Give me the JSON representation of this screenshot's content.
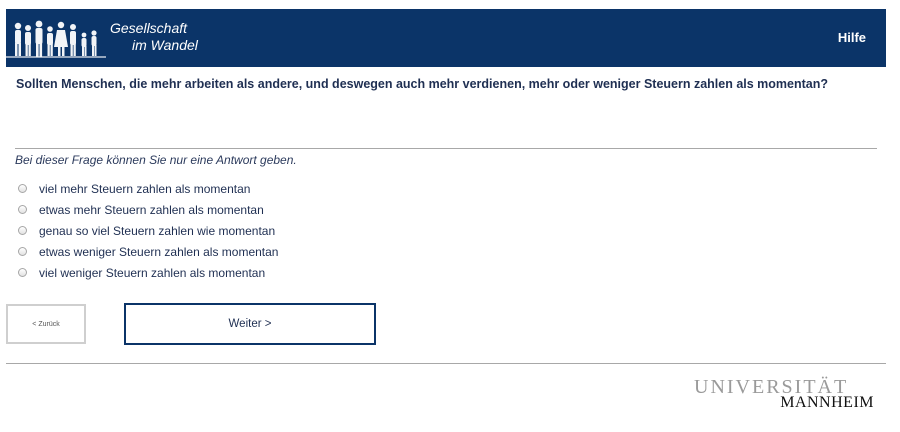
{
  "header": {
    "logo_line1": "Gesellschaft",
    "logo_line2": "im Wandel",
    "help_label": "Hilfe",
    "background_color": "#0b3468"
  },
  "question": {
    "text": "Sollten Menschen, die mehr arbeiten als andere, und deswegen auch mehr verdienen, mehr oder weniger Steuern zahlen als momentan?",
    "instruction": "Bei dieser Frage können Sie nur eine Antwort geben.",
    "options": [
      {
        "label": "viel mehr Steuern zahlen als momentan"
      },
      {
        "label": "etwas mehr Steuern zahlen als momentan"
      },
      {
        "label": "genau so viel Steuern zahlen wie momentan"
      },
      {
        "label": "etwas weniger Steuern zahlen als momentan"
      },
      {
        "label": "viel weniger Steuern zahlen als momentan"
      }
    ]
  },
  "nav": {
    "back_label": "< Zurück",
    "next_label": "Weiter >"
  },
  "footer": {
    "logo_line1": "UNIVERSITÄT",
    "logo_line2": "MANNHEIM"
  }
}
